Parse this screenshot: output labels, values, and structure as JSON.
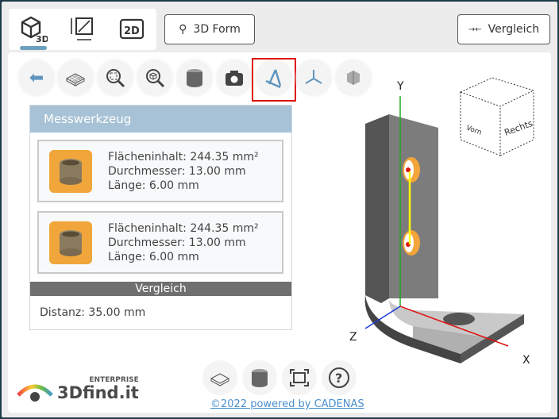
{
  "tabs": [
    {
      "name": "3d",
      "label": "3D",
      "active": true
    },
    {
      "name": "dimensions",
      "active": false
    },
    {
      "name": "2d",
      "label": "2D",
      "active": false
    }
  ],
  "buttons": {
    "form_search": "3D Form",
    "compare": "Vergleich"
  },
  "toolbar": [
    "back",
    "wireframe",
    "zoom-fit",
    "zoom-part",
    "shaded",
    "screenshot",
    "measure",
    "axes",
    "section"
  ],
  "measure": {
    "title": "Messwerkzeug",
    "items": [
      {
        "area": "Flächeninhalt: 244.35 mm²",
        "diameter": "Durchmesser: 13.00 mm",
        "length": "Länge: 6.00 mm"
      },
      {
        "area": "Flächeninhalt: 244.35 mm²",
        "diameter": "Durchmesser: 13.00 mm",
        "length": "Länge: 6.00 mm"
      }
    ],
    "compare_title": "Vergleich",
    "distance": "Distanz: 35.00 mm"
  },
  "viewer": {
    "axis_x": "X",
    "axis_y": "Y",
    "axis_z": "Z",
    "cube_front": "Vorn",
    "cube_right": "Rechts"
  },
  "logo": {
    "edition": "ENTERPRISE",
    "brand": "3Dfind.it"
  },
  "footer": "©2022 powered by CADENAS",
  "colors": {
    "accent": "#6ea0bf",
    "header": "#a7c2d6",
    "highlight": "#e01010",
    "icon_bg": "#f0a63a"
  }
}
